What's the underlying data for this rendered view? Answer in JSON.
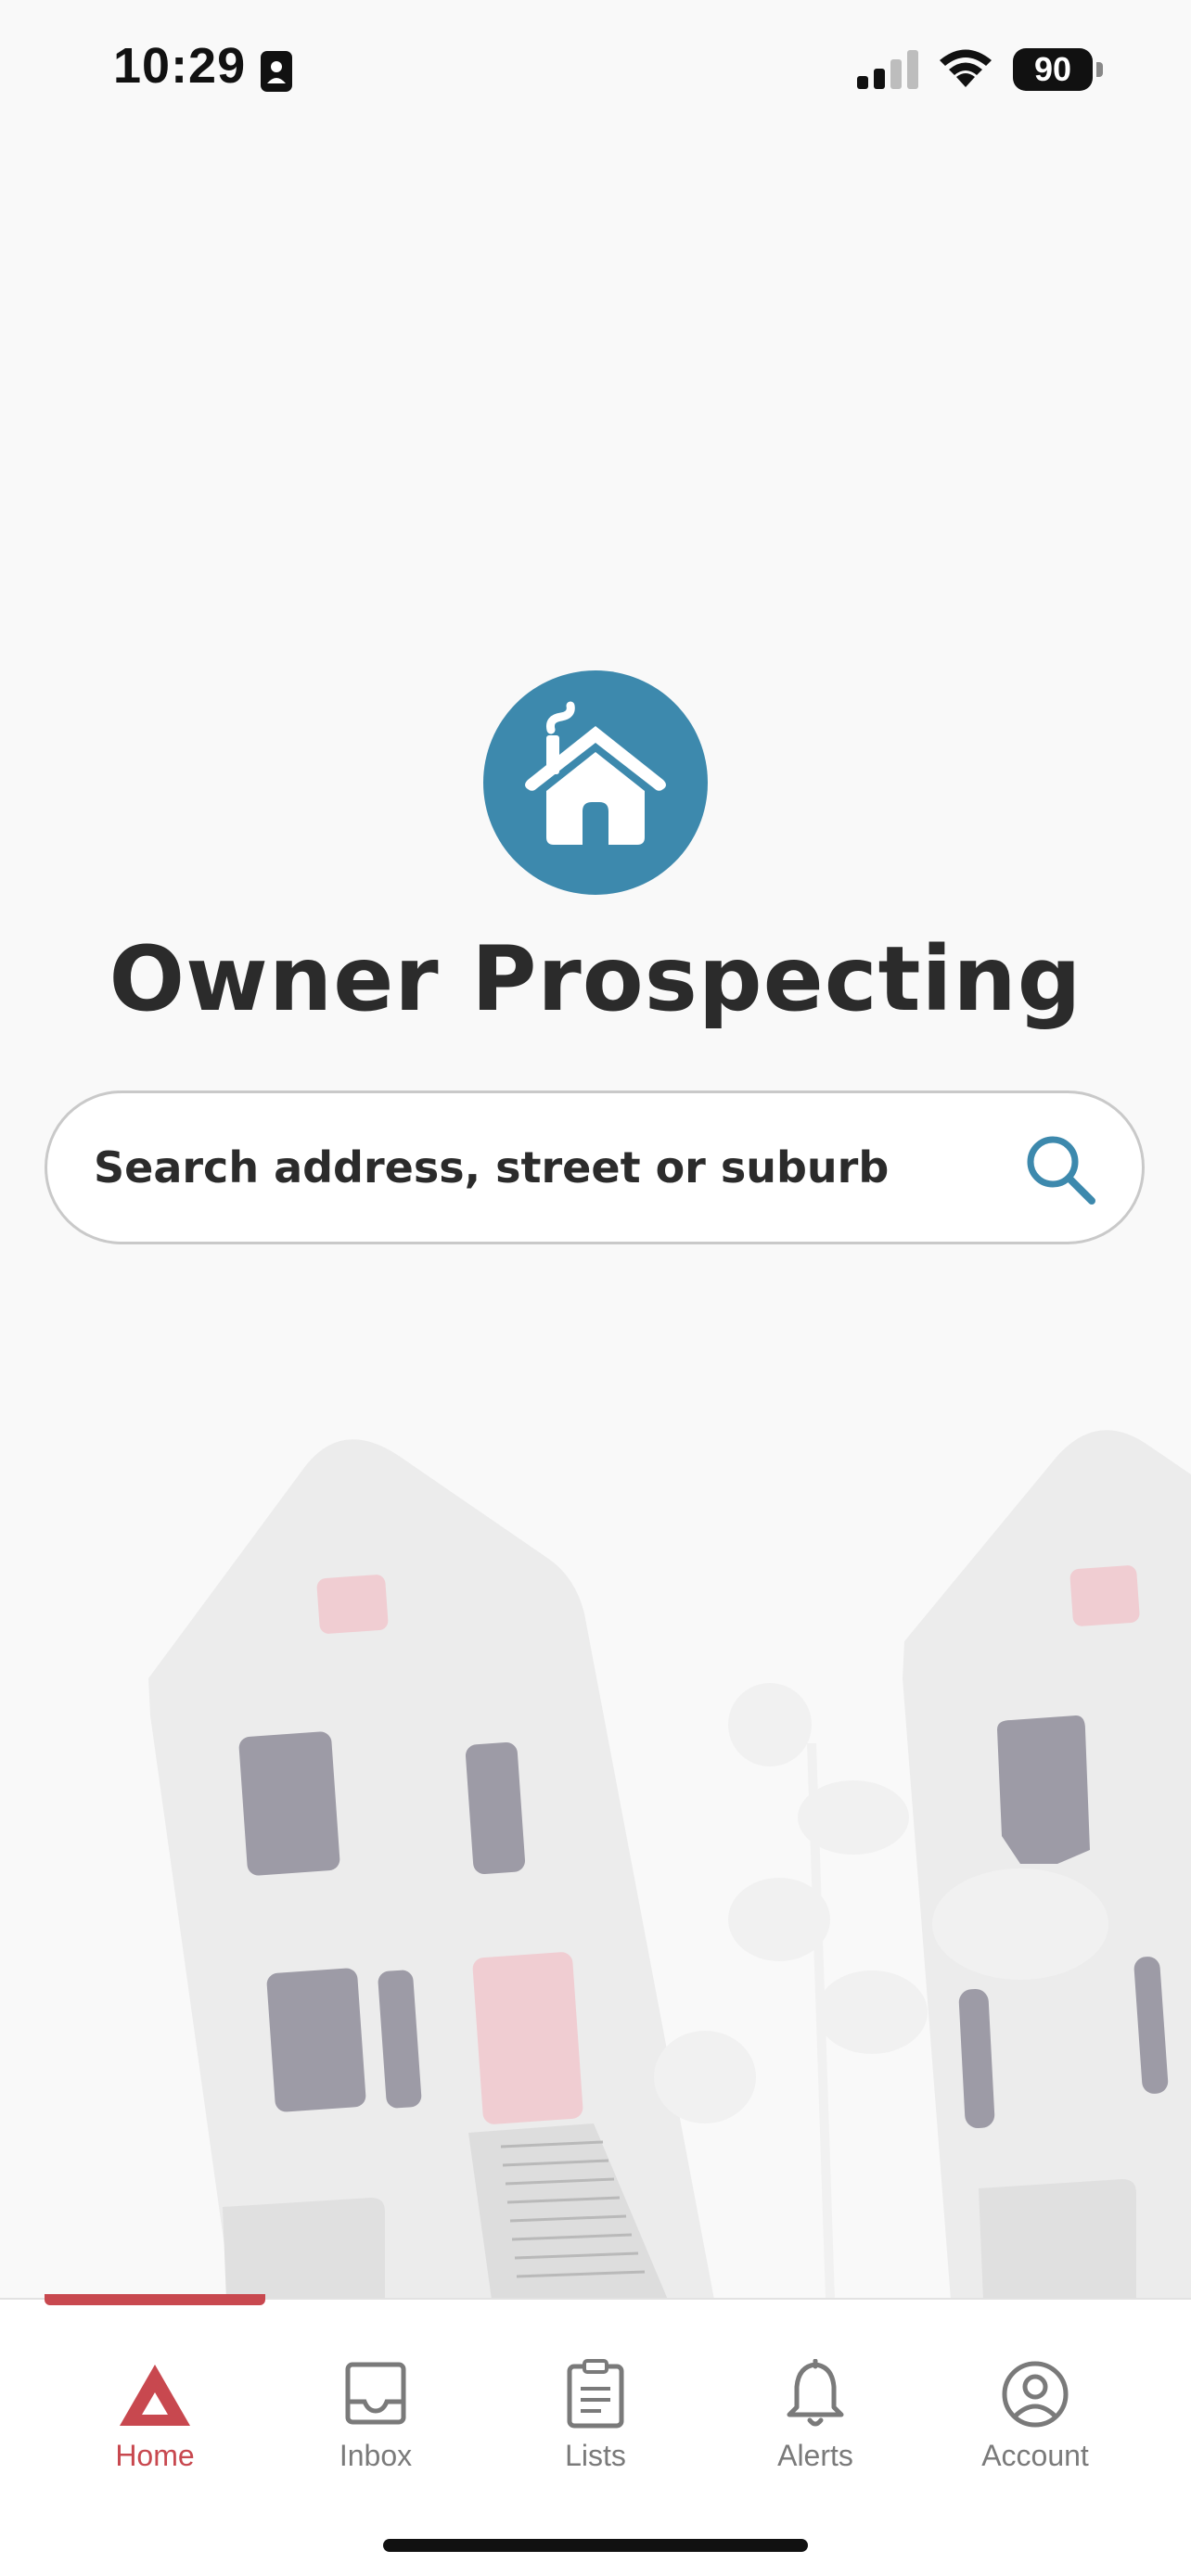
{
  "status_bar": {
    "time": "10:29",
    "battery": "90"
  },
  "hero": {
    "logo_icon": "house-icon",
    "title": "Owner Prospecting"
  },
  "search": {
    "placeholder": "Search address, street or suburb",
    "icon": "search-icon"
  },
  "tab_bar": {
    "active_index": 0,
    "tabs": [
      {
        "label": "Home",
        "icon": "home-triangle-icon"
      },
      {
        "label": "Inbox",
        "icon": "inbox-icon"
      },
      {
        "label": "Lists",
        "icon": "clipboard-list-icon"
      },
      {
        "label": "Alerts",
        "icon": "bell-icon"
      },
      {
        "label": "Account",
        "icon": "account-circle-icon"
      }
    ]
  },
  "colors": {
    "brand_red": "#c8484f",
    "logo_blue": "#3d89ad",
    "search_icon_blue": "#3d89ad",
    "background": "#f9f9f9"
  }
}
